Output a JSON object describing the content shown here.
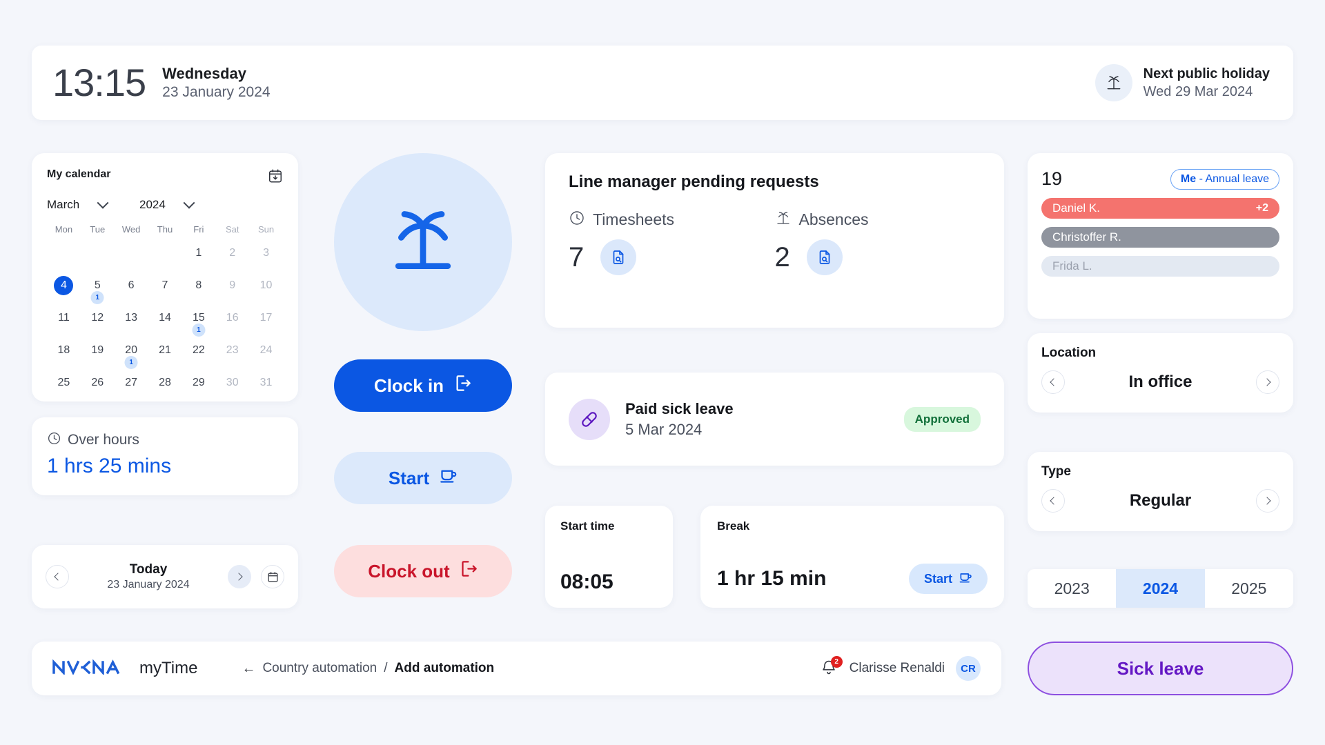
{
  "header": {
    "time": "13:15",
    "weekday": "Wednesday",
    "date": "23 January 2024",
    "holiday_title": "Next public holiday",
    "holiday_date": "Wed 29 Mar 2024",
    "holiday_icon": "palm-tree-icon"
  },
  "calendar": {
    "title": "My calendar",
    "export_icon": "calendar-download-icon",
    "month": "March",
    "year": "2024",
    "dow": [
      "Mon",
      "Tue",
      "Wed",
      "Thu",
      "Fri",
      "Sat",
      "Sun"
    ],
    "weeks": [
      [
        {
          "d": ""
        },
        {
          "d": ""
        },
        {
          "d": ""
        },
        {
          "d": ""
        },
        {
          "d": "1"
        },
        {
          "d": "2",
          "weekend": true
        },
        {
          "d": "3",
          "weekend": true
        }
      ],
      [
        {
          "d": "4",
          "selected": true
        },
        {
          "d": "5",
          "badge": "1"
        },
        {
          "d": "6"
        },
        {
          "d": "7"
        },
        {
          "d": "8"
        },
        {
          "d": "9",
          "weekend": true
        },
        {
          "d": "10",
          "weekend": true
        }
      ],
      [
        {
          "d": "11"
        },
        {
          "d": "12"
        },
        {
          "d": "13"
        },
        {
          "d": "14"
        },
        {
          "d": "15",
          "badge": "1"
        },
        {
          "d": "16",
          "weekend": true
        },
        {
          "d": "17",
          "weekend": true
        }
      ],
      [
        {
          "d": "18"
        },
        {
          "d": "19"
        },
        {
          "d": "20",
          "badge": "1"
        },
        {
          "d": "21"
        },
        {
          "d": "22"
        },
        {
          "d": "23",
          "weekend": true
        },
        {
          "d": "24",
          "weekend": true
        }
      ],
      [
        {
          "d": "25"
        },
        {
          "d": "26"
        },
        {
          "d": "27"
        },
        {
          "d": "28"
        },
        {
          "d": "29"
        },
        {
          "d": "30",
          "weekend": true
        },
        {
          "d": "31",
          "weekend": true
        }
      ]
    ]
  },
  "over_hours": {
    "icon": "clock-icon",
    "label": "Over hours",
    "value": "1 hrs 25 mins"
  },
  "today_nav": {
    "prev_icon": "chevron-left-icon",
    "next_icon": "chevron-right-icon",
    "calendar_icon": "calendar-icon",
    "title": "Today",
    "date": "23 January 2024"
  },
  "center": {
    "palm_icon": "palm-tree-icon",
    "clock_in": "Clock in",
    "clock_in_icon": "sign-in-icon",
    "start": "Start",
    "start_icon": "coffee-cup-icon",
    "clock_out": "Clock out",
    "clock_out_icon": "sign-out-icon"
  },
  "pending": {
    "title": "Line manager pending requests",
    "columns": [
      {
        "label": "Timesheets",
        "icon": "clock-icon",
        "count": "7",
        "action_icon": "document-search-icon"
      },
      {
        "label": "Absences",
        "icon": "palm-tree-icon",
        "count": "2",
        "action_icon": "document-search-icon"
      }
    ]
  },
  "sick_leave_card": {
    "icon": "pill-icon",
    "title": "Paid sick leave",
    "date": "5 Mar 2024",
    "status": "Approved"
  },
  "start_time": {
    "label": "Start time",
    "value": "08:05"
  },
  "break": {
    "label": "Break",
    "value": "1 hr 15 min",
    "button": "Start",
    "button_icon": "coffee-cup-icon"
  },
  "leave_panel": {
    "day_number": "19",
    "tag_bold": "Me",
    "tag_rest": " - Annual leave",
    "people": [
      {
        "name": "Daniel K.",
        "extra": "+2",
        "style": "red"
      },
      {
        "name": "Christoffer R.",
        "extra": "",
        "style": "gray"
      },
      {
        "name": "Frida L.",
        "extra": "",
        "style": "light"
      }
    ]
  },
  "location": {
    "label": "Location",
    "value": "In office",
    "prev_icon": "chevron-left-icon",
    "next_icon": "chevron-right-icon"
  },
  "type": {
    "label": "Type",
    "value": "Regular",
    "prev_icon": "chevron-left-icon",
    "next_icon": "chevron-right-icon"
  },
  "year_selector": {
    "years": [
      "2023",
      "2024",
      "2025"
    ],
    "active": "2024"
  },
  "sick_leave_button": {
    "label": "Sick leave"
  },
  "bottom_bar": {
    "logo": "nokia-logo",
    "product": "myTime",
    "back_icon": "arrow-left-icon",
    "crumb_parent": "Country automation",
    "crumb_sep": "/",
    "crumb_current": "Add automation",
    "bell_icon": "bell-icon",
    "bell_count": "2",
    "user_name": "Clarisse Renaldi",
    "avatar_initials": "CR"
  },
  "colors": {
    "accent_blue": "#0b57e3",
    "light_blue": "#dce9fb",
    "red": "#c9152b",
    "red_bg": "#fddede",
    "green": "#12703a",
    "green_bg": "#d8f7dd",
    "purple": "#6418c4",
    "purple_bg": "#ece2fb",
    "page_bg": "#f4f6fb"
  }
}
